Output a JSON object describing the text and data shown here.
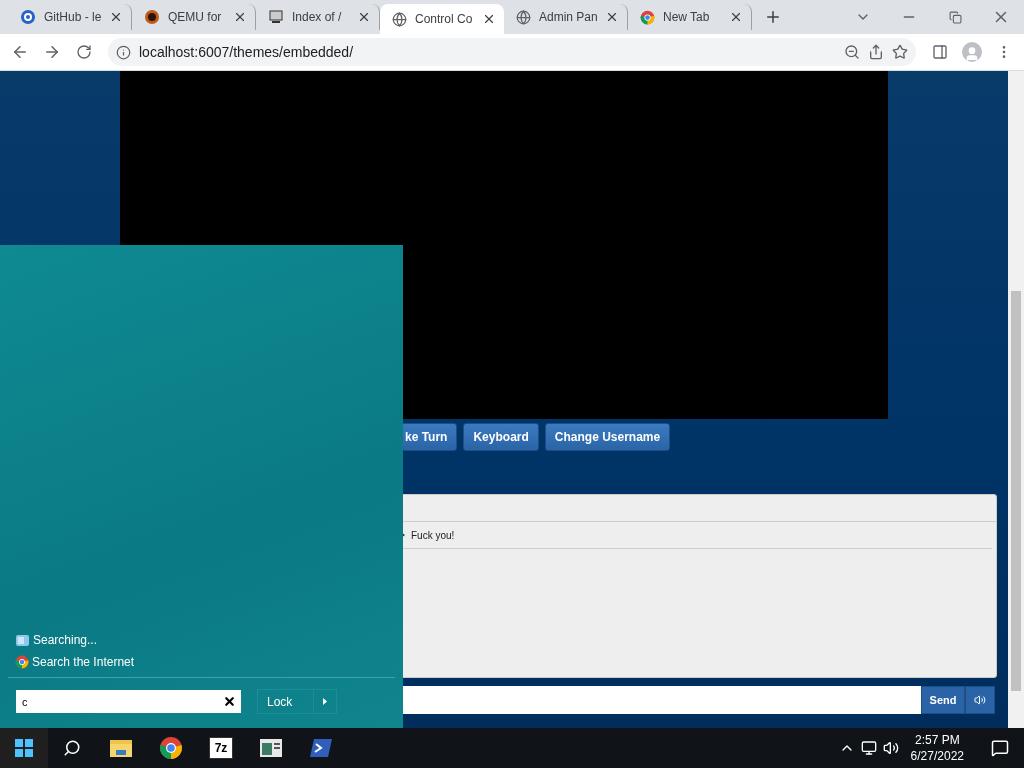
{
  "browser": {
    "tabs": [
      {
        "title": "GitHub - le",
        "kind": "github",
        "selected": false
      },
      {
        "title": "QEMU for",
        "kind": "qemu",
        "selected": false
      },
      {
        "title": "Index of /",
        "kind": "computer",
        "selected": false
      },
      {
        "title": "Control Co",
        "kind": "globe",
        "selected": true
      },
      {
        "title": "Admin Pan",
        "kind": "globe",
        "selected": false
      },
      {
        "title": "New Tab",
        "kind": "chrome",
        "selected": false
      }
    ],
    "address": "localhost:6007/themes/embedded/"
  },
  "page": {
    "buttons": [
      "ke Turn",
      "Keyboard",
      "Change Username"
    ],
    "chat": {
      "messages": [
        {
          "text": "Fuck you!"
        }
      ]
    },
    "send": "Send"
  },
  "start_menu": {
    "results": [
      {
        "label": "Searching...",
        "kind": "files"
      },
      {
        "label": "Search the Internet",
        "kind": "web"
      }
    ],
    "search_value": "c",
    "power_button": "Lock"
  },
  "taskbar": {
    "apps": [
      {
        "kind": "folder"
      },
      {
        "kind": "chrome"
      },
      {
        "kind": "archive",
        "label": "7z"
      },
      {
        "kind": "window"
      },
      {
        "kind": "terminal"
      }
    ],
    "time": "2:57 PM",
    "date": "6/27/2022"
  }
}
